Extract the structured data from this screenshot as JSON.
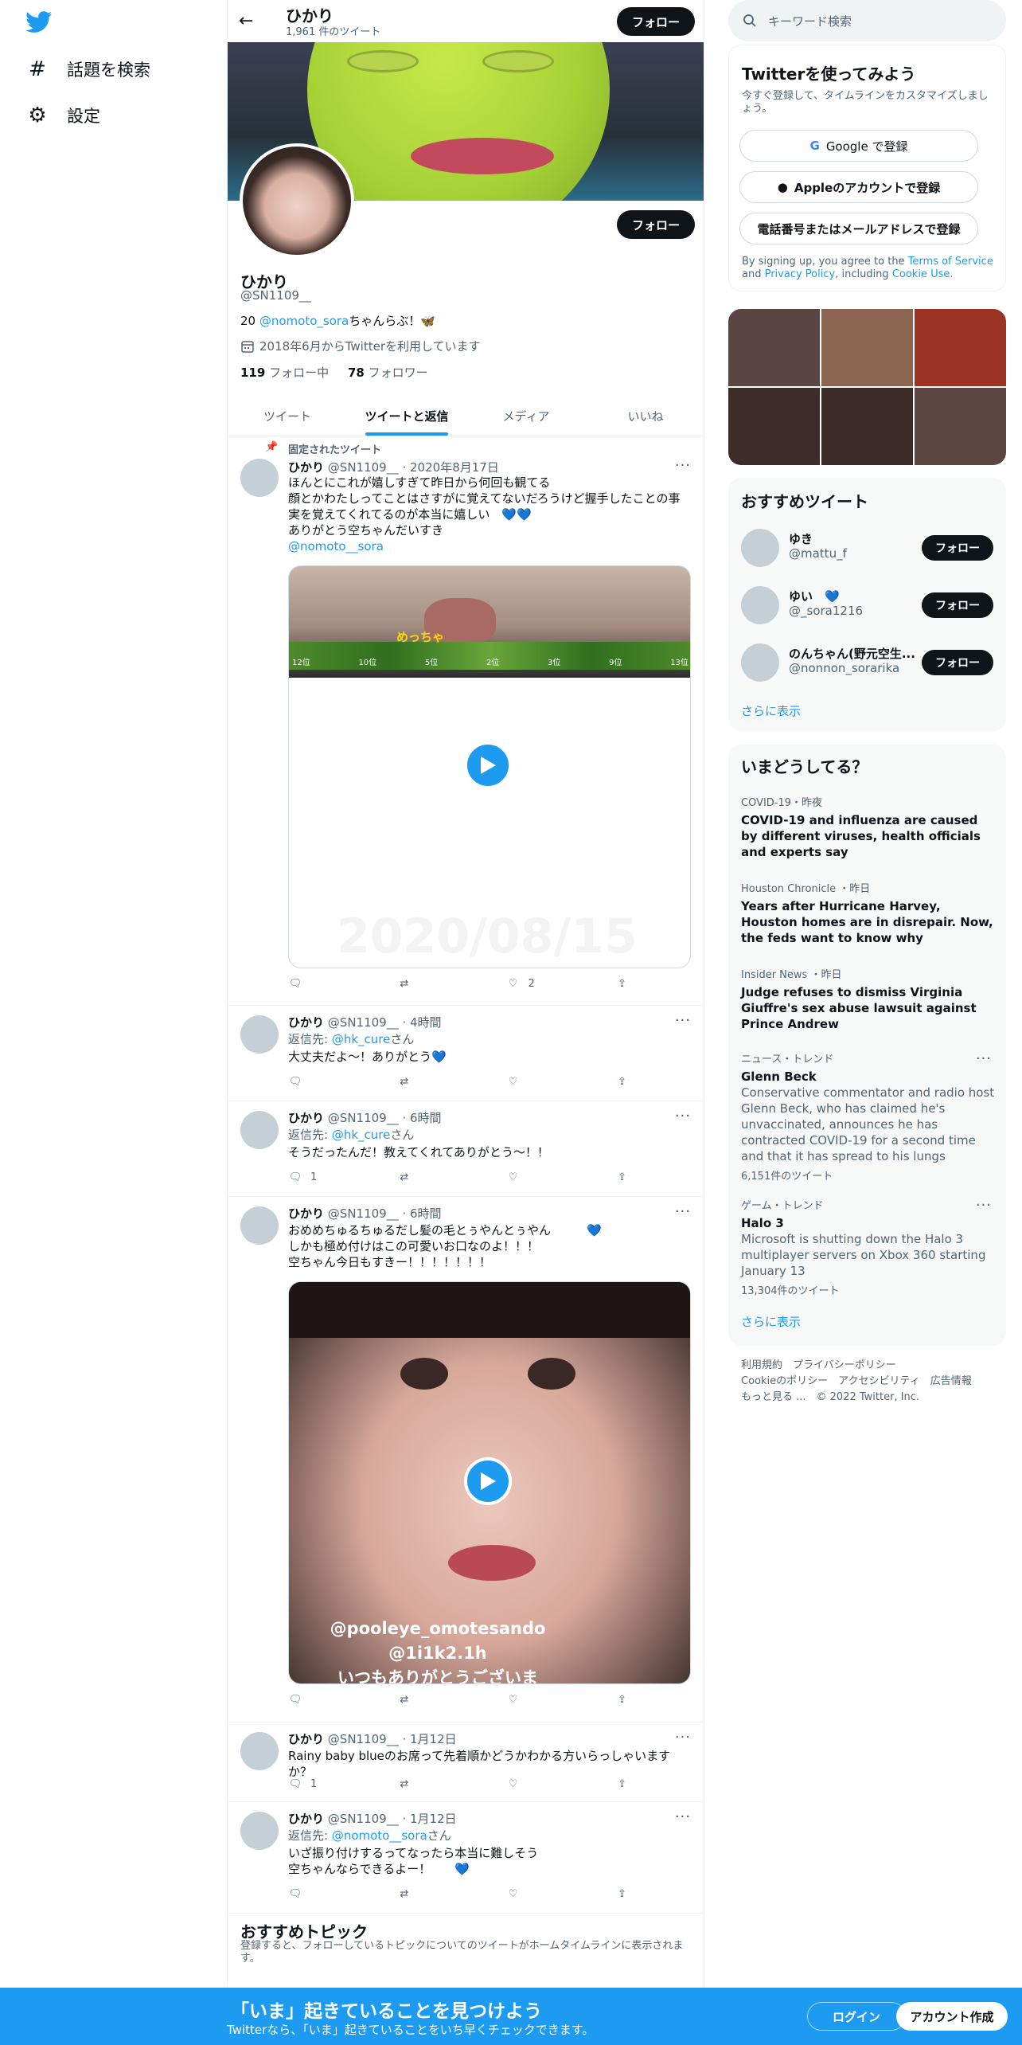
{
  "nav": {
    "explore": "話題を検索",
    "settings": "設定"
  },
  "header": {
    "name": "ひかり",
    "tweet_count": "1,961 件のツイート",
    "follow": "フォロー"
  },
  "profile": {
    "name": "ひかり",
    "handle": "@SN1109__",
    "bio_prefix": "20 ",
    "bio_mention": "@nomoto_sora",
    "bio_suffix": "ちゃんらぶ！🦋",
    "joined": "2018年6月からTwitterを利用しています",
    "following_count": "119",
    "following_label": " フォロー中",
    "followers_count": "78",
    "followers_label": " フォロワー",
    "follow": "フォロー"
  },
  "tabs": [
    "ツイート",
    "ツイートと返信",
    "メディア",
    "いいね"
  ],
  "pinned_label": "固定されたツイート",
  "tweets": [
    {
      "name": "ひかり",
      "meta": "@SN1109__ · 2020年8月17日",
      "lines": [
        "ほんとにこれが嬉しすぎて昨日から何回も観てる",
        "顔とかわたしってことはさすがに覚えてないだろうけど握手したことの事",
        "実を覚えてくれてるのが本当に嬉しい　💙💙",
        "ありがとう空ちゃんだいすき"
      ],
      "mention": "@nomoto__sora",
      "media_caption": "めっちゃ",
      "watermark": "2020/08/15",
      "rank_labels": [
        "12位",
        "10位",
        "5位",
        "2位",
        "3位",
        "9位",
        "13位"
      ],
      "likes": "2"
    },
    {
      "name": "ひかり",
      "meta": "@SN1109__ · 4時間",
      "reply_prefix": "返信先: ",
      "reply_to": "@hk_cure",
      "reply_suffix": "さん",
      "text": "大丈夫だよ〜！ありがとう💙"
    },
    {
      "name": "ひかり",
      "meta": "@SN1109__ · 6時間",
      "reply_prefix": "返信先: ",
      "reply_to": "@hk_cure",
      "reply_suffix": "さん",
      "text": "そうだったんだ！教えてくれてありがとう〜！！",
      "replies": "1"
    },
    {
      "name": "ひかり",
      "meta": "@SN1109__ · 6時間",
      "lines": [
        "おめめちゅるちゅるだし髪の毛とぅやんとぅやん　　　💙",
        "しかも極め付けはこの可愛いお口なのよ！！！",
        "空ちゃん今日もすきー！！！！！！！"
      ],
      "video_text": [
        "@pooleye_omotesando",
        "@1i1k2.1h",
        "いつもありがとうございま"
      ]
    },
    {
      "name": "ひかり",
      "meta": "@SN1109__ · 1月12日",
      "text": "Rainy baby blueのお席って先着順かどうかわかる方いらっしゃいますか？",
      "replies": "1"
    },
    {
      "name": "ひかり",
      "meta": "@SN1109__ · 1月12日",
      "reply_prefix": "返信先: ",
      "reply_to": "@nomoto__sora",
      "reply_suffix": "さん",
      "lines": [
        "いざ振り付けするってなったら本当に難しそう",
        "空ちゃんならできるよー！　　💙"
      ]
    }
  ],
  "topics": {
    "title": "おすすめトピック",
    "desc": "登録すると、フォローしているトピックについてのツイートがホームタイムラインに表示されます。"
  },
  "search": {
    "placeholder": "キーワード検索"
  },
  "signup": {
    "title": "Twitterを使ってみよう",
    "sub": "今すぐ登録して、タイムラインをカスタマイズしましょう。",
    "google": "Google で登録",
    "apple": "Appleのアカウントで登録",
    "phone": "電話番号またはメールアドレスで登録",
    "legal_prefix": "By signing up, you agree to the ",
    "terms": "Terms of Service",
    "and": " and ",
    "privacy": "Privacy Policy",
    "including": ", including ",
    "cookie": "Cookie Use."
  },
  "photo_colors": [
    "#5a4545",
    "#8b6552",
    "#9c3426",
    "#3d2c2a",
    "#3b2a25",
    "#5d4642"
  ],
  "who_to_follow": {
    "title": "おすすめツイート",
    "users": [
      {
        "name": "ゆき",
        "handle": "@mattu_f"
      },
      {
        "name": "ゆい　💙",
        "handle": "@_sora1216"
      },
      {
        "name": "のんちゃん(野元空生...",
        "handle": "@nonnon_sorarika"
      }
    ],
    "follow": "フォロー",
    "more": "さらに表示"
  },
  "trends": {
    "title": "いまどうしてる？",
    "items": [
      {
        "meta": "COVID-19・昨夜",
        "title": "COVID-19 and influenza are caused by different viruses, health officials and experts say"
      },
      {
        "meta": "Houston Chronicle ・昨日",
        "title": "Years after Hurricane Harvey, Houston homes are in disrepair. Now, the feds want to know why"
      },
      {
        "meta": "Insider News ・昨日",
        "title": "Judge refuses to dismiss Virginia Giuffre's sex abuse lawsuit against Prince Andrew"
      },
      {
        "meta": "ニュース・トレンド",
        "title": "Glenn Beck",
        "desc": "Conservative commentator and radio host Glenn Beck, who has claimed he's unvaccinated, announces he has contracted COVID-19 for a second time and that it has spread to his lungs",
        "count": "6,151件のツイート"
      },
      {
        "meta": "ゲーム・トレンド",
        "title": "Halo 3",
        "desc": "Microsoft is shutting down the Halo 3 multiplayer servers on Xbox 360 starting January 13",
        "count": "13,304件のツイート"
      }
    ],
    "more": "さらに表示"
  },
  "footer": {
    "line1": "利用規約　プライバシーポリシー",
    "line2": "Cookieのポリシー　アクセシビリティ　広告情報",
    "line3": "もっと見る ...　© 2022 Twitter, Inc."
  },
  "bottom": {
    "title": "「いま」起きていることを見つけよう",
    "sub": "Twitterなら、「いま」起きていることをいち早くチェックできます。",
    "login": "ログイン",
    "signup": "アカウント作成"
  }
}
